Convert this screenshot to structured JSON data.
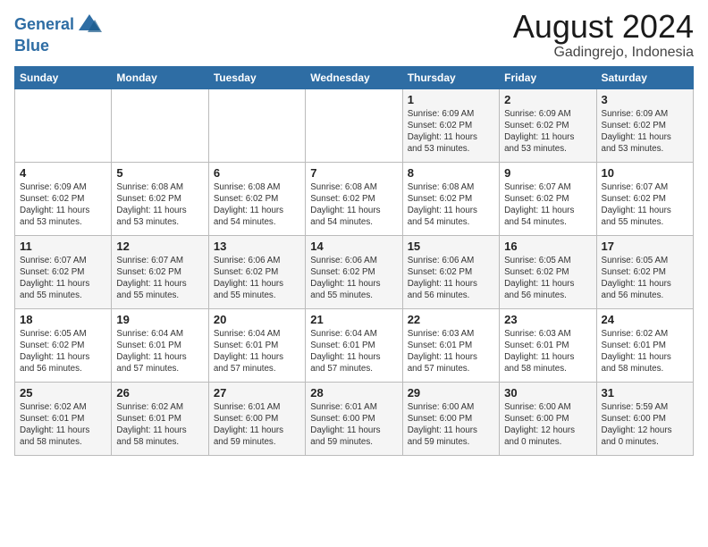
{
  "header": {
    "logo_line1": "General",
    "logo_line2": "Blue",
    "month_year": "August 2024",
    "location": "Gadingrejo, Indonesia"
  },
  "weekdays": [
    "Sunday",
    "Monday",
    "Tuesday",
    "Wednesday",
    "Thursday",
    "Friday",
    "Saturday"
  ],
  "weeks": [
    [
      {
        "day": "",
        "info": ""
      },
      {
        "day": "",
        "info": ""
      },
      {
        "day": "",
        "info": ""
      },
      {
        "day": "",
        "info": ""
      },
      {
        "day": "1",
        "info": "Sunrise: 6:09 AM\nSunset: 6:02 PM\nDaylight: 11 hours\nand 53 minutes."
      },
      {
        "day": "2",
        "info": "Sunrise: 6:09 AM\nSunset: 6:02 PM\nDaylight: 11 hours\nand 53 minutes."
      },
      {
        "day": "3",
        "info": "Sunrise: 6:09 AM\nSunset: 6:02 PM\nDaylight: 11 hours\nand 53 minutes."
      }
    ],
    [
      {
        "day": "4",
        "info": "Sunrise: 6:09 AM\nSunset: 6:02 PM\nDaylight: 11 hours\nand 53 minutes."
      },
      {
        "day": "5",
        "info": "Sunrise: 6:08 AM\nSunset: 6:02 PM\nDaylight: 11 hours\nand 53 minutes."
      },
      {
        "day": "6",
        "info": "Sunrise: 6:08 AM\nSunset: 6:02 PM\nDaylight: 11 hours\nand 54 minutes."
      },
      {
        "day": "7",
        "info": "Sunrise: 6:08 AM\nSunset: 6:02 PM\nDaylight: 11 hours\nand 54 minutes."
      },
      {
        "day": "8",
        "info": "Sunrise: 6:08 AM\nSunset: 6:02 PM\nDaylight: 11 hours\nand 54 minutes."
      },
      {
        "day": "9",
        "info": "Sunrise: 6:07 AM\nSunset: 6:02 PM\nDaylight: 11 hours\nand 54 minutes."
      },
      {
        "day": "10",
        "info": "Sunrise: 6:07 AM\nSunset: 6:02 PM\nDaylight: 11 hours\nand 55 minutes."
      }
    ],
    [
      {
        "day": "11",
        "info": "Sunrise: 6:07 AM\nSunset: 6:02 PM\nDaylight: 11 hours\nand 55 minutes."
      },
      {
        "day": "12",
        "info": "Sunrise: 6:07 AM\nSunset: 6:02 PM\nDaylight: 11 hours\nand 55 minutes."
      },
      {
        "day": "13",
        "info": "Sunrise: 6:06 AM\nSunset: 6:02 PM\nDaylight: 11 hours\nand 55 minutes."
      },
      {
        "day": "14",
        "info": "Sunrise: 6:06 AM\nSunset: 6:02 PM\nDaylight: 11 hours\nand 55 minutes."
      },
      {
        "day": "15",
        "info": "Sunrise: 6:06 AM\nSunset: 6:02 PM\nDaylight: 11 hours\nand 56 minutes."
      },
      {
        "day": "16",
        "info": "Sunrise: 6:05 AM\nSunset: 6:02 PM\nDaylight: 11 hours\nand 56 minutes."
      },
      {
        "day": "17",
        "info": "Sunrise: 6:05 AM\nSunset: 6:02 PM\nDaylight: 11 hours\nand 56 minutes."
      }
    ],
    [
      {
        "day": "18",
        "info": "Sunrise: 6:05 AM\nSunset: 6:02 PM\nDaylight: 11 hours\nand 56 minutes."
      },
      {
        "day": "19",
        "info": "Sunrise: 6:04 AM\nSunset: 6:01 PM\nDaylight: 11 hours\nand 57 minutes."
      },
      {
        "day": "20",
        "info": "Sunrise: 6:04 AM\nSunset: 6:01 PM\nDaylight: 11 hours\nand 57 minutes."
      },
      {
        "day": "21",
        "info": "Sunrise: 6:04 AM\nSunset: 6:01 PM\nDaylight: 11 hours\nand 57 minutes."
      },
      {
        "day": "22",
        "info": "Sunrise: 6:03 AM\nSunset: 6:01 PM\nDaylight: 11 hours\nand 57 minutes."
      },
      {
        "day": "23",
        "info": "Sunrise: 6:03 AM\nSunset: 6:01 PM\nDaylight: 11 hours\nand 58 minutes."
      },
      {
        "day": "24",
        "info": "Sunrise: 6:02 AM\nSunset: 6:01 PM\nDaylight: 11 hours\nand 58 minutes."
      }
    ],
    [
      {
        "day": "25",
        "info": "Sunrise: 6:02 AM\nSunset: 6:01 PM\nDaylight: 11 hours\nand 58 minutes."
      },
      {
        "day": "26",
        "info": "Sunrise: 6:02 AM\nSunset: 6:01 PM\nDaylight: 11 hours\nand 58 minutes."
      },
      {
        "day": "27",
        "info": "Sunrise: 6:01 AM\nSunset: 6:00 PM\nDaylight: 11 hours\nand 59 minutes."
      },
      {
        "day": "28",
        "info": "Sunrise: 6:01 AM\nSunset: 6:00 PM\nDaylight: 11 hours\nand 59 minutes."
      },
      {
        "day": "29",
        "info": "Sunrise: 6:00 AM\nSunset: 6:00 PM\nDaylight: 11 hours\nand 59 minutes."
      },
      {
        "day": "30",
        "info": "Sunrise: 6:00 AM\nSunset: 6:00 PM\nDaylight: 12 hours\nand 0 minutes."
      },
      {
        "day": "31",
        "info": "Sunrise: 5:59 AM\nSunset: 6:00 PM\nDaylight: 12 hours\nand 0 minutes."
      }
    ]
  ]
}
